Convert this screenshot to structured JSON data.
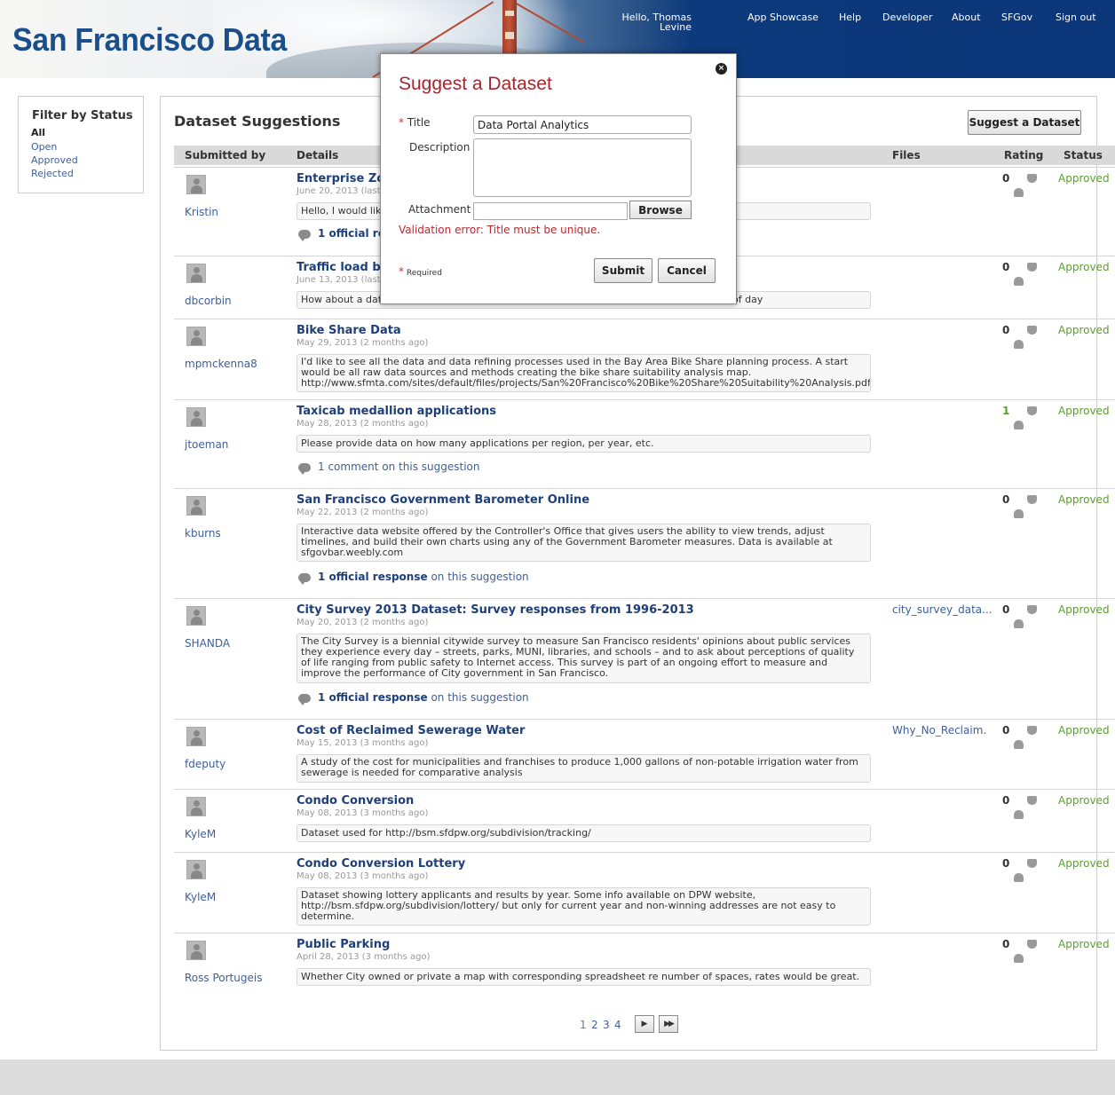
{
  "header": {
    "logo": "San Francisco Data",
    "greeting": "Hello, Thomas Levine",
    "nav": [
      "App Showcase",
      "Help",
      "Developer",
      "About",
      "SFGov",
      "Sign out"
    ]
  },
  "filter": {
    "title": "Filter by Status",
    "items": [
      "All",
      "Open",
      "Approved",
      "Rejected"
    ],
    "active": "All"
  },
  "panel": {
    "title": "Dataset Suggestions",
    "suggest_button": "Suggest a Dataset",
    "columns": [
      "Submitted by",
      "Details",
      "Files",
      "Rating",
      "Status"
    ]
  },
  "rows": [
    {
      "user": "Kristin",
      "title": "Enterprise Zone",
      "date": "June 20, 2013 (last",
      "desc": "Hello, I would lik",
      "comments_count": "1 official re",
      "comments_suffix": "",
      "file": "",
      "rating": "0",
      "status": "Approved"
    },
    {
      "user": "dbcorbin",
      "title": "Traffic load by",
      "date": "June 13, 2013 (last",
      "desc": "How about a dat",
      "desc_tail": "of day",
      "file": "",
      "rating": "0",
      "status": "Approved"
    },
    {
      "user": "mpmckenna8",
      "title": "Bike Share Data",
      "date": "May 29, 2013 (2 months ago)",
      "desc": "I'd like to see all the data and data refining processes used in the Bay Area Bike Share planning process. A start would be all raw data sources and methods creating the bike share suitability analysis map. http://www.sfmta.com/sites/default/files/projects/San%20Francisco%20Bike%20Share%20Suitability%20Analysis.pdf",
      "file": "",
      "rating": "0",
      "status": "Approved"
    },
    {
      "user": "jtoeman",
      "title": "Taxicab medallion applications",
      "date": "May 28, 2013 (2 months ago)",
      "desc": "Please provide data on how many applications per region, per year, etc.",
      "comments_count": "1 comment",
      "comments_suffix": "on this suggestion",
      "file": "",
      "rating": "1",
      "status": "Approved"
    },
    {
      "user": "kburns",
      "title": "San Francisco Government Barometer Online",
      "date": "May 22, 2013 (2 months ago)",
      "desc": "Interactive data website offered by the Controller's Office that gives users the ability to view trends, adjust timelines, and build their own charts using any of the Government Barometer measures. Data is available at sfgovbar.weebly.com",
      "comments_count": "1 official response",
      "comments_suffix": "on this suggestion",
      "file": "",
      "rating": "0",
      "status": "Approved"
    },
    {
      "user": "SHANDA",
      "title": "City Survey 2013 Dataset: Survey responses from 1996-2013",
      "date": "May 20, 2013 (2 months ago)",
      "desc": "The City Survey is a biennial citywide survey to measure San Francisco residents' opinions about public services they experience every day – streets, parks, MUNI, libraries, and schools – and to ask about perceptions of quality of life ranging from public safety to Internet access. This survey is part of an ongoing effort to measure and improve the performance of City government in San Francisco.",
      "comments_count": "1 official response",
      "comments_suffix": "on this suggestion",
      "file": "city_survey_data...",
      "rating": "0",
      "status": "Approved"
    },
    {
      "user": "fdeputy",
      "title": "Cost of Reclaimed Sewerage Water",
      "date": "May 15, 2013 (3 months ago)",
      "desc": "A study of the cost for municipalities and franchises to produce 1,000 gallons of non-potable irrigation water from sewerage is needed for comparative analysis",
      "file": "Why_No_Reclaim.",
      "rating": "0",
      "status": "Approved"
    },
    {
      "user": "KyleM",
      "title": "Condo Conversion",
      "date": "May 08, 2013 (3 months ago)",
      "desc": "Dataset used for http://bsm.sfdpw.org/subdivision/tracking/",
      "file": "",
      "rating": "0",
      "status": "Approved"
    },
    {
      "user": "KyleM",
      "title": "Condo Conversion Lottery",
      "date": "May 08, 2013 (3 months ago)",
      "desc": "Dataset showing lottery applicants and results by year. Some info available on DPW website, http://bsm.sfdpw.org/subdivision/lottery/ but only for current year and non-winning addresses are not easy to determine.",
      "file": "",
      "rating": "0",
      "status": "Approved"
    },
    {
      "user": "Ross Portugeis",
      "title": "Public Parking",
      "date": "April 28, 2013 (3 months ago)",
      "desc": "Whether City owned or private a map with corresponding spreadsheet re number of spaces, rates would be great.",
      "file": "",
      "rating": "0",
      "status": "Approved"
    }
  ],
  "pagination": {
    "pages": [
      "1",
      "2",
      "3",
      "4"
    ],
    "current": "1",
    "next": "▶",
    "last": "▶▶"
  },
  "modal": {
    "title": "Suggest a Dataset",
    "close": "×",
    "title_label": "Title",
    "title_value": "Data Portal Analytics",
    "description_label": "Description",
    "description_value": "",
    "attachment_label": "Attachment",
    "attachment_value": "",
    "browse": "Browse",
    "error": "Validation error: Title must be unique.",
    "required_star": "*",
    "required_note": "Required",
    "submit": "Submit",
    "cancel": "Cancel"
  },
  "colors": {
    "brand_red": "#a9242c",
    "link": "#3d5f9b",
    "approved": "#5aa02c",
    "header_blue": "#0b3679"
  }
}
